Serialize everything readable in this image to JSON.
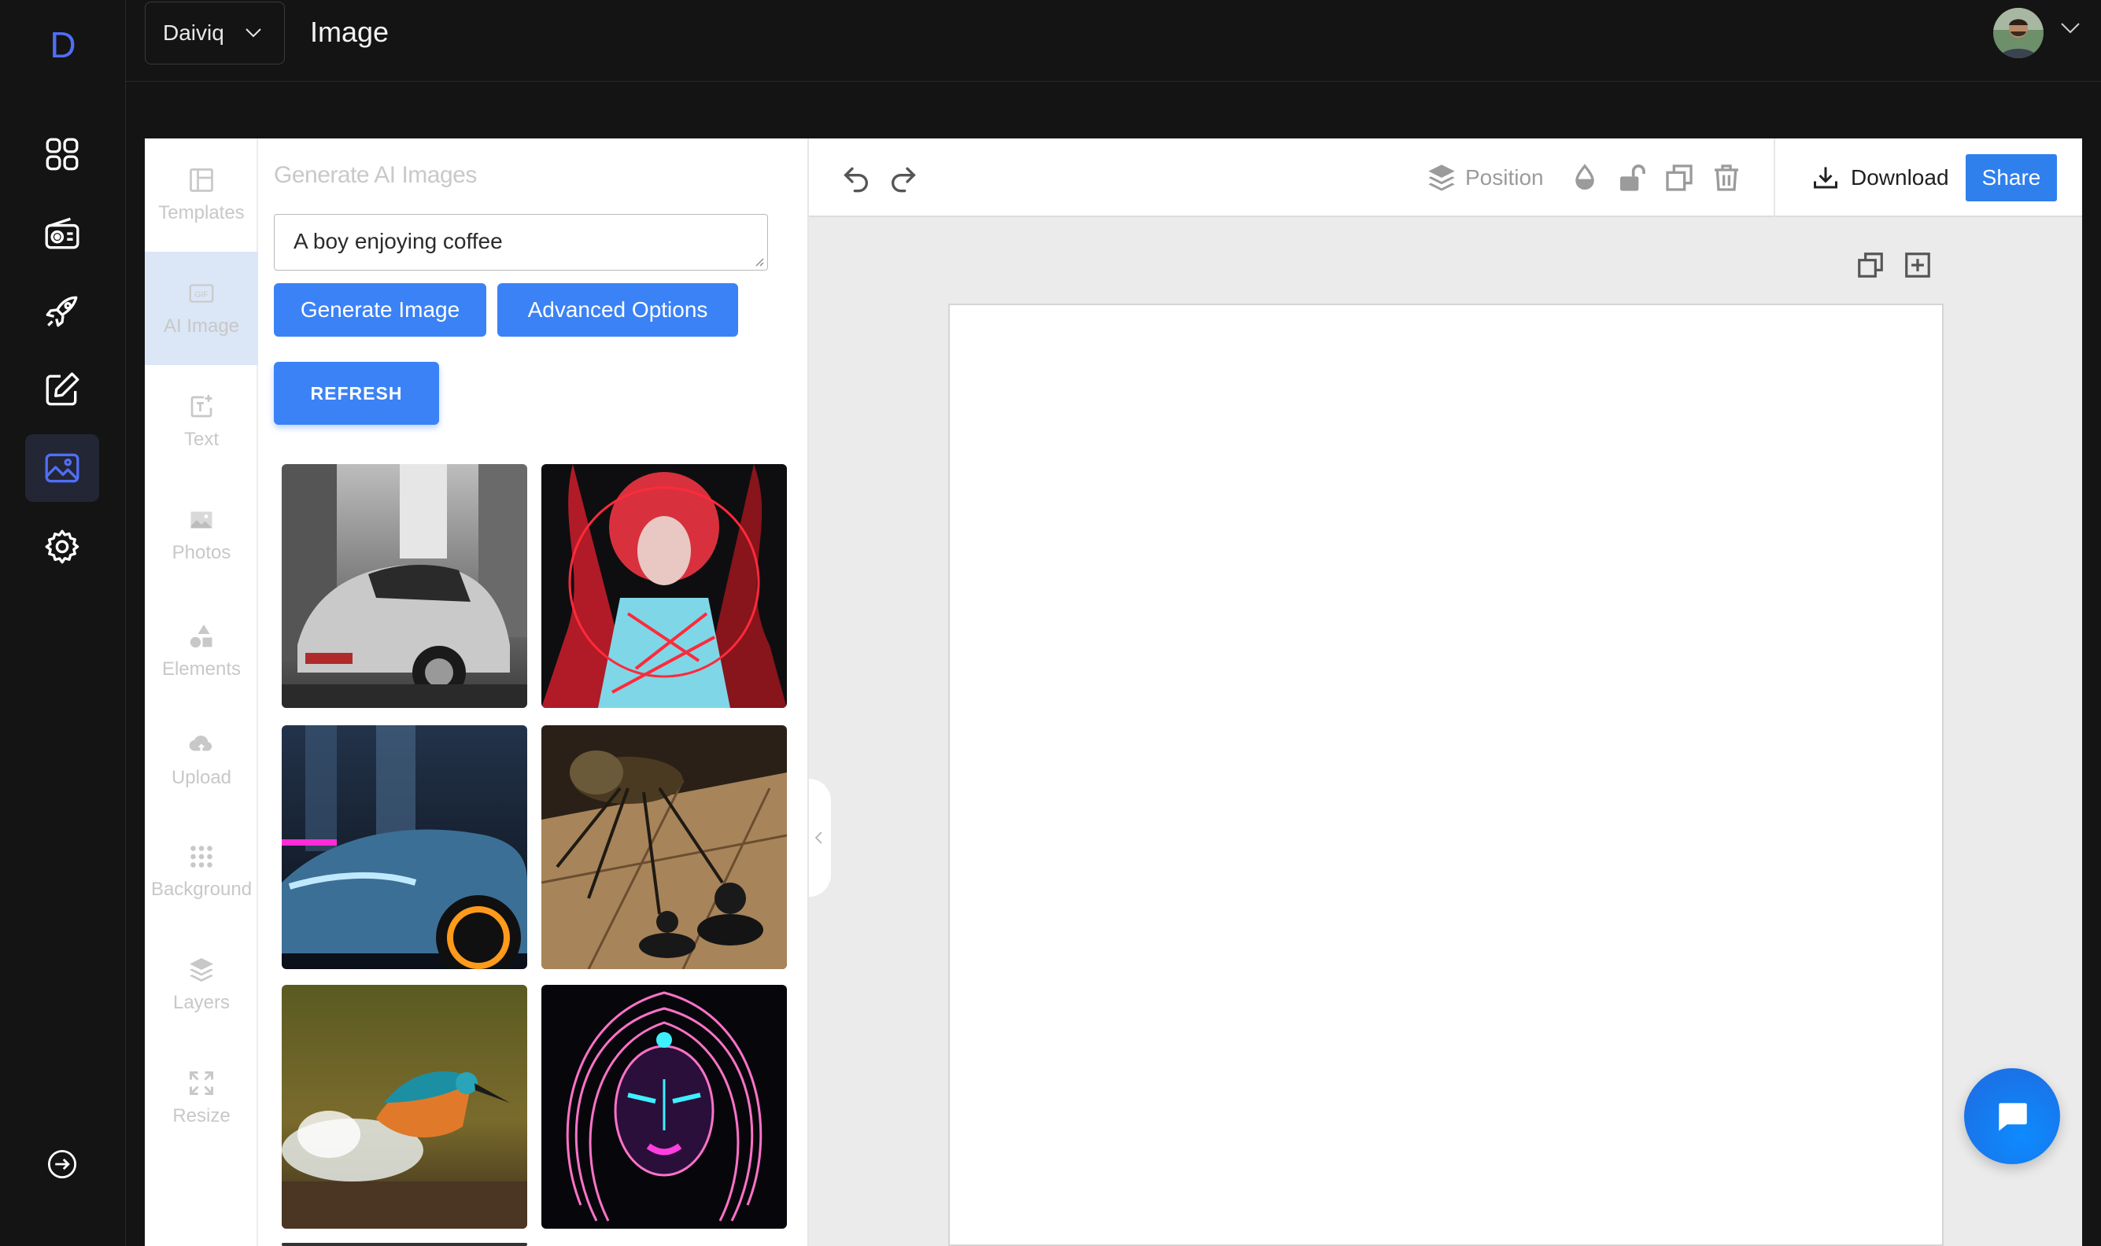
{
  "app": {
    "logo_letter": "D",
    "org_name": "Daiviq",
    "page_title": "Image"
  },
  "rail": {
    "items": [
      {
        "icon": "grid-icon"
      },
      {
        "icon": "radio-icon"
      },
      {
        "icon": "rocket-icon"
      },
      {
        "icon": "edit-icon"
      },
      {
        "icon": "image-icon",
        "active": true
      },
      {
        "icon": "gear-icon"
      }
    ],
    "bottom_icon": "logout-icon"
  },
  "tools": [
    {
      "label": "Templates",
      "icon": "templates-icon"
    },
    {
      "label": "AI Image",
      "icon": "gif-icon",
      "active": true
    },
    {
      "label": "Text",
      "icon": "text-icon"
    },
    {
      "label": "Photos",
      "icon": "photos-icon"
    },
    {
      "label": "Elements",
      "icon": "elements-icon"
    },
    {
      "label": "Upload",
      "icon": "upload-icon"
    },
    {
      "label": "Background",
      "icon": "background-icon"
    },
    {
      "label": "Layers",
      "icon": "layers-icon"
    },
    {
      "label": "Resize",
      "icon": "resize-icon"
    }
  ],
  "panel": {
    "title": "Generate AI Images",
    "prompt_value": "A boy enjoying coffee",
    "generate_label": "Generate Image",
    "advanced_label": "Advanced Options",
    "refresh_label": "REFRESH"
  },
  "toolbar": {
    "position_label": "Position",
    "download_label": "Download",
    "share_label": "Share"
  },
  "colors": {
    "accent": "#3b82f6",
    "share": "#2f80ed",
    "logo": "#4f6ef7"
  }
}
